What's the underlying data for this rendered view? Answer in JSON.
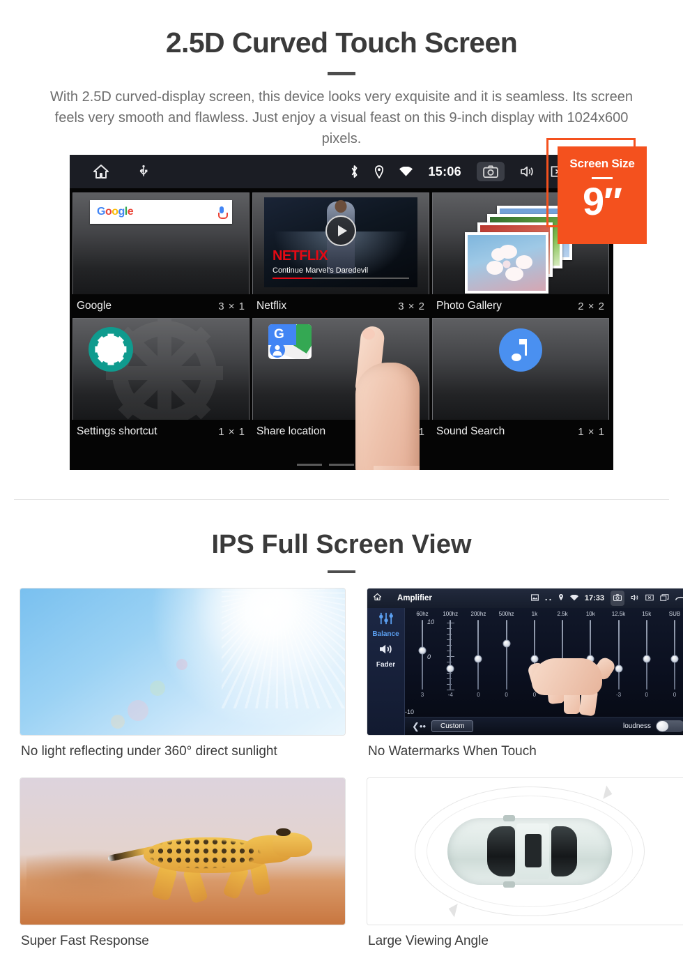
{
  "section1": {
    "title": "2.5D Curved Touch Screen",
    "description": "With 2.5D curved-display screen, this device looks very exquisite and it is seamless. Its screen feels very smooth and flawless. Just enjoy a visual feast on this 9-inch display with 1024x600 pixels."
  },
  "badge": {
    "title": "Screen Size",
    "value": "9″",
    "color": "#f4511e"
  },
  "android": {
    "statusbar": {
      "time": "15:06",
      "left_icons": [
        "home-icon",
        "usb-icon"
      ],
      "right_icons": [
        "bluetooth-icon",
        "location-icon",
        "wifi-icon",
        "camera-icon",
        "volume-icon",
        "close-icon",
        "recents-icon"
      ]
    },
    "widgets": [
      {
        "label": "Google",
        "size": "3 × 1",
        "icon": "google-search-widget",
        "search_logo": "Google"
      },
      {
        "label": "Netflix",
        "size": "3 × 2",
        "icon": "netflix-widget",
        "brand": "NETFLIX",
        "caption": "Continue Marvel's Daredevil"
      },
      {
        "label": "Photo Gallery",
        "size": "2 × 2",
        "icon": "photo-gallery-widget"
      },
      {
        "label": "Settings shortcut",
        "size": "1 × 1",
        "icon": "settings-gear-icon"
      },
      {
        "label": "Share location",
        "size": "1 × 1",
        "icon": "google-maps-icon"
      },
      {
        "label": "Sound Search",
        "size": "1 × 1",
        "icon": "music-note-icon"
      }
    ],
    "page_indicator": {
      "pages": 3,
      "active": 3
    }
  },
  "section2": {
    "title": "IPS Full Screen View",
    "cards": [
      {
        "caption": "No light reflecting under 360° direct sunlight",
        "image": "blue-sky-with-sun-flare"
      },
      {
        "caption": "No Watermarks When Touch",
        "image": "amplifier-equalizer-screenshot"
      },
      {
        "caption": "Super Fast Response",
        "image": "running-cheetah"
      },
      {
        "caption": "Large Viewing Angle",
        "image": "car-top-view-rotation"
      }
    ]
  },
  "amplifier": {
    "title": "Amplifier",
    "time": "17:33",
    "sidebar": [
      {
        "label": "Balance",
        "icon": "equalizer-icon"
      },
      {
        "label": "Fader",
        "icon": "speaker-icon"
      }
    ],
    "scale": {
      "top": "10",
      "bottom": "-10",
      "mid": "0"
    },
    "bands": [
      "60hz",
      "100hz",
      "200hz",
      "500hz",
      "1k",
      "2.5k",
      "10k",
      "12.5k",
      "15k",
      "SUB"
    ],
    "values": [
      "3",
      "-4",
      "0",
      "0",
      "0",
      "-3",
      "0",
      "-3",
      "0",
      "0"
    ],
    "preset_button": "Custom",
    "loudness_label": "loudness",
    "loudness_on": false
  }
}
